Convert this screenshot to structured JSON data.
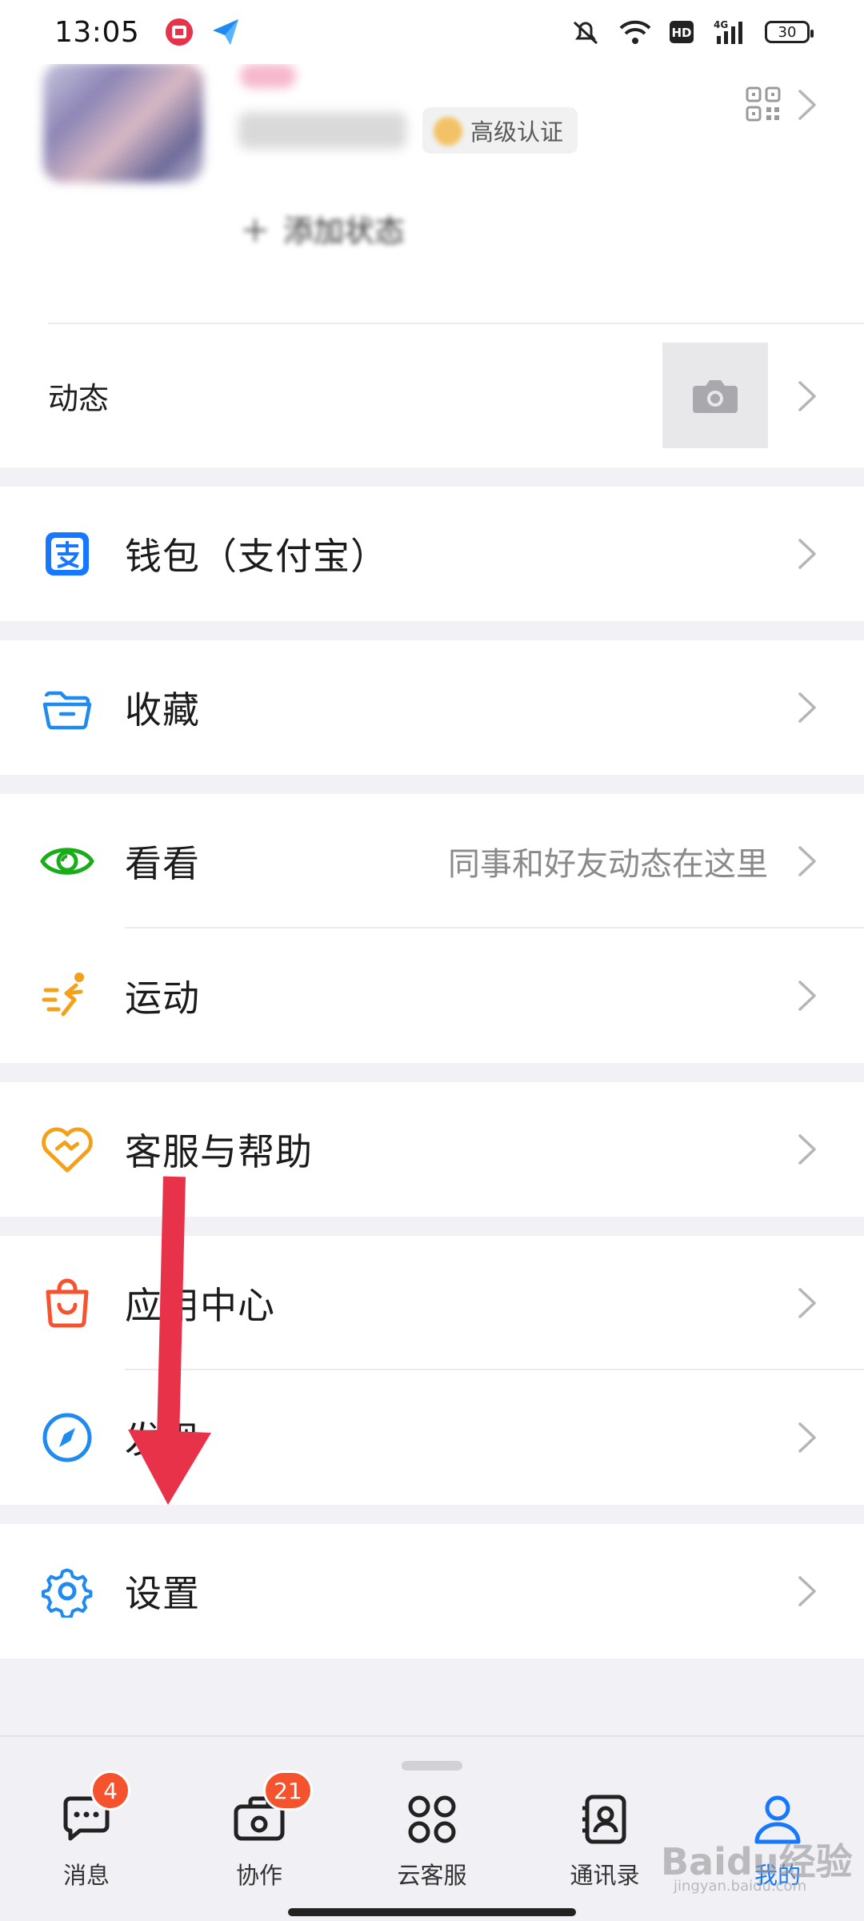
{
  "status_bar": {
    "time": "13:05",
    "battery": "30"
  },
  "profile": {
    "certification": "高级认证",
    "add_status": "添加状态",
    "feed_label": "动态"
  },
  "menu": {
    "wallet": "钱包（支付宝）",
    "favorites": "收藏",
    "discover_feed": "看看",
    "discover_feed_hint": "同事和好友动态在这里",
    "sports": "运动",
    "support": "客服与帮助",
    "app_center": "应用中心",
    "discover": "发现",
    "settings": "设置"
  },
  "bottom_nav": {
    "items": [
      {
        "label": "消息",
        "badge": "4"
      },
      {
        "label": "协作",
        "badge": "21"
      },
      {
        "label": "云客服"
      },
      {
        "label": "通讯录"
      },
      {
        "label": "我的"
      }
    ]
  },
  "watermark": {
    "brand": "Baidu经验",
    "url": "jingyan.baidu.com"
  },
  "colors": {
    "accent": "#1677ff",
    "badge": "#f5532d",
    "annotation_arrow": "#e8324a"
  }
}
